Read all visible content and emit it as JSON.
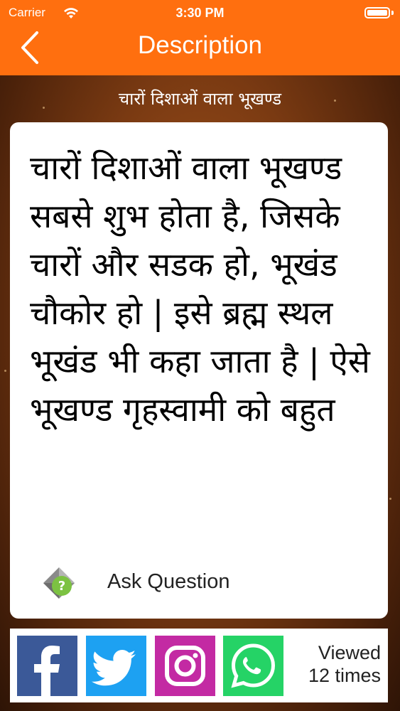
{
  "status_bar": {
    "carrier": "Carrier",
    "time": "3:30 PM"
  },
  "nav": {
    "title": "Description",
    "back_icon": "chevron-left-icon"
  },
  "sub_title": "चारों दिशाओं वाला भूखण्ड",
  "content": {
    "body": "चारों दिशाओं वाला भूखण्ड सबसे शुभ होता है, जिसके चारों और सडक हो, भूखंड चौकोर हो | इसे ब्रह्म स्थल भूखंड भी कहा जाता है | ऐसे भूखण्ड गृहस्वामी को बहुत"
  },
  "ask": {
    "label": "Ask Question",
    "icon": "question-icon"
  },
  "share": {
    "facebook_icon": "facebook-icon",
    "twitter_icon": "twitter-icon",
    "instagram_icon": "instagram-icon",
    "whatsapp_icon": "whatsapp-icon",
    "colors": {
      "facebook": "#3b5998",
      "twitter": "#1da1f2",
      "instagram": "#c32aa3",
      "whatsapp": "#25d366"
    }
  },
  "views": {
    "line1": "Viewed",
    "line2": "12 times"
  },
  "colors": {
    "accent": "#ff6f0f",
    "card": "#ffffff"
  }
}
